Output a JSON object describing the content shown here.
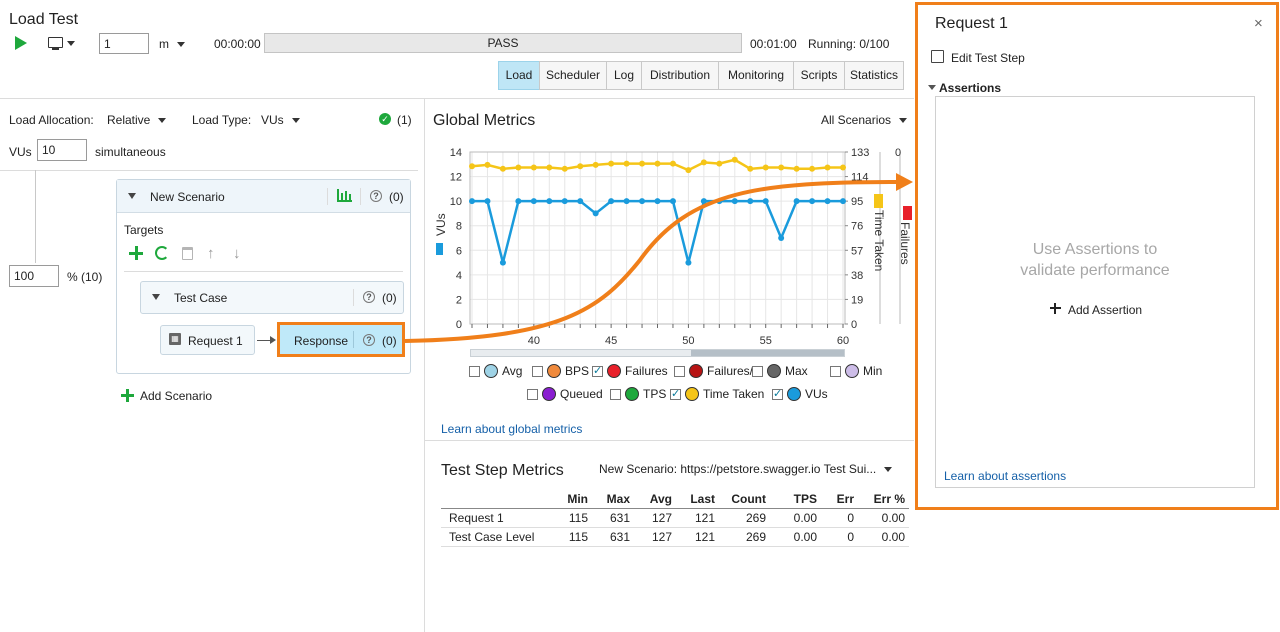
{
  "header": {
    "title": "Load Test",
    "duration_value": "1",
    "duration_unit": "m",
    "elapsed": "00:00:00",
    "status": "PASS",
    "total_time": "00:01:00",
    "running": "Running: 0/100",
    "tabs": [
      "Load",
      "Scheduler",
      "Log",
      "Distribution",
      "Monitoring",
      "Scripts",
      "Statistics"
    ],
    "active_tab": "Load"
  },
  "left": {
    "load_allocation_label": "Load Allocation:",
    "load_allocation_value": "Relative",
    "load_type_label": "Load Type:",
    "load_type_value": "VUs",
    "check_count": "(1)",
    "vus_label": "VUs",
    "vus_value": "10",
    "vus_suffix": "simultaneous",
    "percent_value": "100",
    "percent_label": "% (10)",
    "scenario_name": "New Scenario",
    "scenario_count": "(0)",
    "targets_label": "Targets",
    "test_case_name": "Test Case",
    "test_case_count": "(0)",
    "request_name": "Request 1",
    "response_name": "Response",
    "response_count": "(0)",
    "add_scenario": "Add Scenario"
  },
  "global_metrics": {
    "title": "Global Metrics",
    "filter": "All Scenarios",
    "learn_link": "Learn about global metrics",
    "legend": [
      {
        "label": "Avg",
        "color": "#9fd3e6",
        "checked": false
      },
      {
        "label": "BPS",
        "color": "#f08a3c",
        "checked": false
      },
      {
        "label": "Failures",
        "color": "#e8202a",
        "checked": true
      },
      {
        "label": "Failures/s",
        "color": "#b81414",
        "checked": false
      },
      {
        "label": "Max",
        "color": "#666666",
        "checked": false
      },
      {
        "label": "Min",
        "color": "#cdbde8",
        "checked": false
      },
      {
        "label": "Queued",
        "color": "#8a1ed1",
        "checked": false
      },
      {
        "label": "TPS",
        "color": "#1ea83c",
        "checked": false
      },
      {
        "label": "Time Taken",
        "color": "#f5c518",
        "checked": true
      },
      {
        "label": "VUs",
        "color": "#1a9bdc",
        "checked": true
      }
    ]
  },
  "chart_data": {
    "type": "line",
    "x": [
      36,
      37,
      38,
      39,
      40,
      41,
      42,
      43,
      44,
      45,
      46,
      47,
      48,
      49,
      50,
      51,
      52,
      53,
      54,
      55,
      56,
      57,
      58,
      59,
      60
    ],
    "xticks": [
      "40",
      "45",
      "50",
      "55",
      "60"
    ],
    "y_left_label": "VUs",
    "y_left_ticks": [
      "0",
      "2",
      "4",
      "6",
      "8",
      "10",
      "12",
      "14"
    ],
    "y_left_range": [
      0,
      14
    ],
    "y_right1_label": "Time Taken",
    "y_right1_ticks": [
      "0",
      "19",
      "38",
      "57",
      "76",
      "95",
      "114",
      "133"
    ],
    "y_right1_range": [
      0,
      133
    ],
    "y_right2_label": "Failures",
    "y_right2_ticks": [
      "0"
    ],
    "series": [
      {
        "name": "VUs",
        "color": "#1a9bdc",
        "axis": "left",
        "values": [
          10,
          10,
          5,
          10,
          10,
          10,
          10,
          10,
          9,
          10,
          10,
          10,
          10,
          10,
          5,
          10,
          10,
          10,
          10,
          10,
          7,
          10,
          10,
          10,
          10
        ]
      },
      {
        "name": "Time Taken",
        "color": "#f5c518",
        "axis": "right1",
        "values": [
          122,
          123,
          120,
          121,
          121,
          121,
          120,
          122,
          123,
          124,
          124,
          124,
          124,
          124,
          119,
          125,
          124,
          127,
          120,
          121,
          121,
          120,
          120,
          121,
          121
        ]
      }
    ]
  },
  "test_step_metrics": {
    "title": "Test Step Metrics",
    "filter": "New Scenario: https://petstore.swagger.io Test Sui...",
    "columns": [
      "",
      "Min",
      "Max",
      "Avg",
      "Last",
      "Count",
      "TPS",
      "Err",
      "Err %"
    ],
    "rows": [
      [
        "Request 1",
        "115",
        "631",
        "127",
        "121",
        "269",
        "0.00",
        "0",
        "0.00"
      ],
      [
        "Test Case Level",
        "115",
        "631",
        "127",
        "121",
        "269",
        "0.00",
        "0",
        "0.00"
      ]
    ]
  },
  "right_panel": {
    "title": "Request 1",
    "edit_label": "Edit Test Step",
    "assertions_label": "Assertions",
    "placeholder_line1": "Use Assertions to",
    "placeholder_line2": "validate performance",
    "add_assertion": "Add Assertion",
    "learn_link": "Learn about assertions"
  }
}
